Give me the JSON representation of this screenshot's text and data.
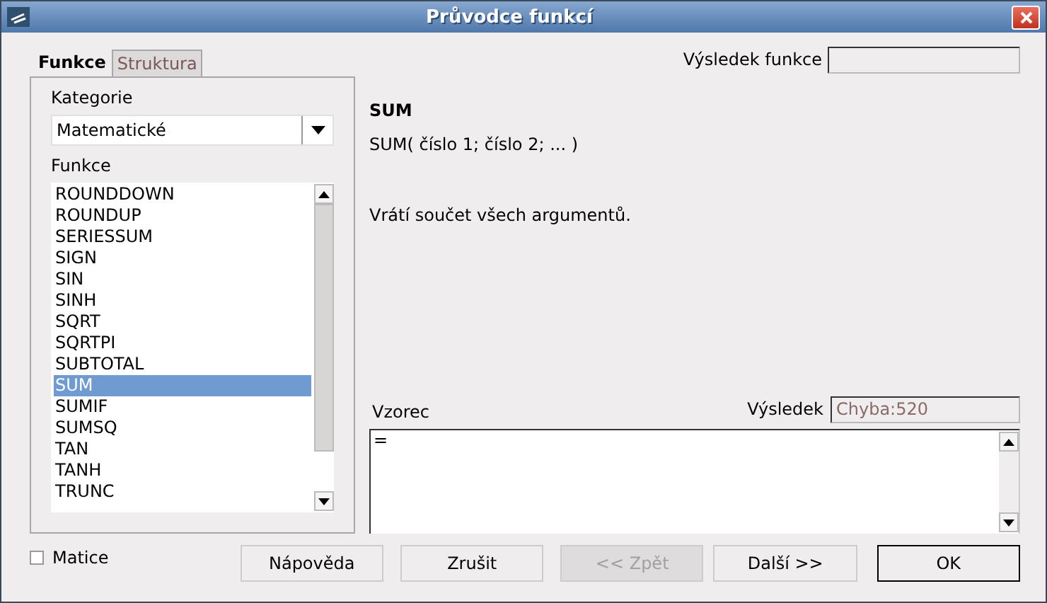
{
  "window": {
    "title": "Průvodce funkcí"
  },
  "tabs": [
    {
      "label": "Funkce",
      "selected": true
    },
    {
      "label": "Struktura",
      "selected": false
    }
  ],
  "category": {
    "label": "Kategorie",
    "value": "Matematické"
  },
  "functions": {
    "label": "Funkce",
    "items": [
      {
        "label": "ROUNDDOWN",
        "selected": false
      },
      {
        "label": "ROUNDUP",
        "selected": false
      },
      {
        "label": "SERIESSUM",
        "selected": false
      },
      {
        "label": "SIGN",
        "selected": false
      },
      {
        "label": "SIN",
        "selected": false
      },
      {
        "label": "SINH",
        "selected": false
      },
      {
        "label": "SQRT",
        "selected": false
      },
      {
        "label": "SQRTPI",
        "selected": false
      },
      {
        "label": "SUBTOTAL",
        "selected": false
      },
      {
        "label": "SUM",
        "selected": true
      },
      {
        "label": "SUMIF",
        "selected": false
      },
      {
        "label": "SUMSQ",
        "selected": false
      },
      {
        "label": "TAN",
        "selected": false
      },
      {
        "label": "TANH",
        "selected": false
      },
      {
        "label": "TRUNC",
        "selected": false
      }
    ]
  },
  "function_result": {
    "label": "Výsledek funkce"
  },
  "detail": {
    "name": "SUM",
    "syntax": "SUM( číslo 1; číslo 2; ...  )",
    "description": "Vrátí součet všech argumentů."
  },
  "formula": {
    "label": "Vzorec",
    "value": "="
  },
  "result": {
    "label": "Výsledek",
    "value": "Chyba:520"
  },
  "matrix": {
    "label": "Matice",
    "checked": false
  },
  "buttons": [
    {
      "label": "Nápověda",
      "disabled": false,
      "default": false
    },
    {
      "label": "Zrušit",
      "disabled": false,
      "default": false
    },
    {
      "label": "<< Zpět",
      "disabled": true,
      "default": false
    },
    {
      "label": "Další >>",
      "disabled": false,
      "default": false
    },
    {
      "label": "OK",
      "disabled": false,
      "default": true
    }
  ]
}
